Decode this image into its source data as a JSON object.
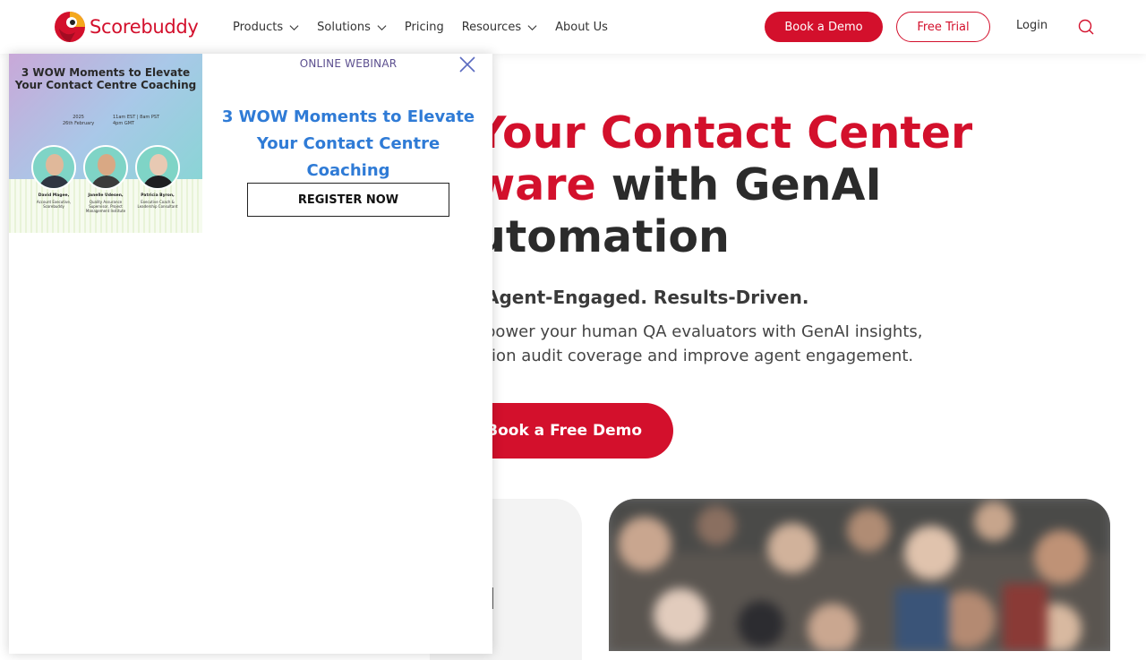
{
  "brand": {
    "name": "Scorebuddy",
    "accent": "#d3102c"
  },
  "nav": {
    "items": [
      {
        "label": "Products",
        "dropdown": true
      },
      {
        "label": "Solutions",
        "dropdown": true
      },
      {
        "label": "Pricing",
        "dropdown": false
      },
      {
        "label": "Resources",
        "dropdown": true
      },
      {
        "label": "About Us",
        "dropdown": false
      }
    ],
    "book_demo": "Book a Demo",
    "free_trial": "Free Trial",
    "login": "Login"
  },
  "hero": {
    "line1_red": "Your Contact Center",
    "line2_red": "ware",
    "line2_dark": " with GenAI",
    "line3_dark": "utomation",
    "subtitle": "Agent-Engaged. Results-Driven.",
    "desc1": "power your human QA evaluators with GenAI insights,",
    "desc2": "tion audit coverage and improve agent engagement.",
    "cta": "Book a Free Demo"
  },
  "popup": {
    "eyebrow": "ONLINE WEBINAR",
    "title": "3 WOW Moments to Elevate Your Contact Centre Coaching",
    "register": "REGISTER NOW",
    "poster": {
      "title": "3 WOW Moments to Elevate Your Contact Centre Coaching",
      "date_year": "2025",
      "date_day": "26th February",
      "time1": "11am EST | 8am PST",
      "time2": "4pm GMT",
      "speakers": [
        {
          "name": "David Magee,",
          "role": "Account Executive, Scorebuddy"
        },
        {
          "name": "Janelle Udesen,",
          "role": "Quality Assurance Supervisor, Project Management Institute"
        },
        {
          "name": "Patricia Byron,",
          "role": "Executive Coach & Leadership Consultant"
        }
      ]
    }
  }
}
